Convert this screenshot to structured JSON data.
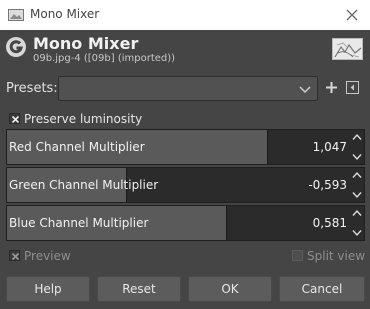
{
  "window": {
    "title": "Mono Mixer",
    "close_icon": "close-icon",
    "app_icon": "image-icon"
  },
  "header": {
    "title": "Mono Mixer",
    "subtitle": "09b.jpg-4 ([09b] (imported))",
    "logo_icon": "gimp-logo-icon",
    "thumbnail_icon": "image-thumbnail"
  },
  "presets": {
    "label": "Presets:",
    "value": "",
    "add_icon": "plus-icon",
    "menu_icon": "menu-arrow-icon"
  },
  "preserve_luminosity": {
    "label": "Preserve luminosity",
    "checked": true
  },
  "channels": [
    {
      "label": "Red Channel Multiplier",
      "value": "1,047",
      "fill_fraction": 0.73
    },
    {
      "label": "Green Channel Multiplier",
      "value": "-0,593",
      "fill_fraction": 0.335
    },
    {
      "label": "Blue Channel Multiplier",
      "value": "0,581",
      "fill_fraction": 0.615
    }
  ],
  "preview": {
    "label": "Preview",
    "checked": true
  },
  "split_view": {
    "label": "Split view",
    "checked": false
  },
  "buttons": {
    "help": "Help",
    "reset": "Reset",
    "ok": "OK",
    "cancel": "Cancel"
  }
}
